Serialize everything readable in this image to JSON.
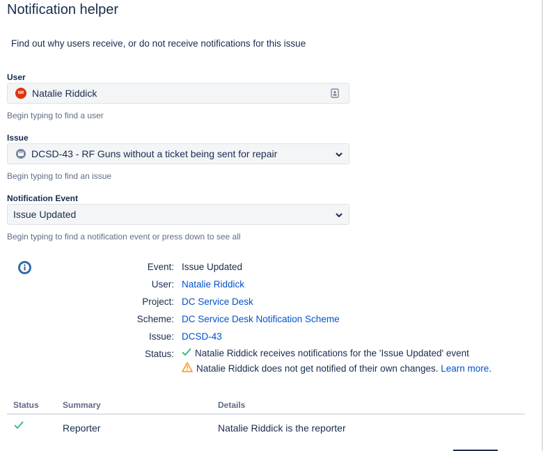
{
  "page": {
    "title": "Notification helper",
    "description": "Find out why users receive, or do not receive notifications for this issue"
  },
  "form": {
    "user": {
      "label": "User",
      "avatar_initials": "NR",
      "value": "Natalie Riddick",
      "helper": "Begin typing to find a user",
      "icon": "contact-card-icon"
    },
    "issue": {
      "label": "Issue",
      "value": "DCSD-43 - RF Guns without a ticket being sent for repair",
      "helper": "Begin typing to find an issue",
      "icon": "issue-type-icon"
    },
    "event": {
      "label": "Notification Event",
      "value": "Issue Updated",
      "helper": "Begin typing to find a notification event or press down to see all"
    }
  },
  "result": {
    "event_key": "Event:",
    "event_val": "Issue Updated",
    "user_key": "User:",
    "user_val": "Natalie Riddick",
    "project_key": "Project:",
    "project_val": "DC Service Desk",
    "scheme_key": "Scheme:",
    "scheme_val": "DC Service Desk Notification Scheme",
    "issue_key": "Issue:",
    "issue_val": "DCSD-43",
    "status_key": "Status:",
    "status_ok": "Natalie Riddick receives notifications for the 'Issue Updated' event",
    "status_warn": "Natalie Riddick does not get notified of their own changes.",
    "learn_more": "Learn more",
    "learn_more_suffix": "."
  },
  "table": {
    "headers": [
      "Status",
      "Summary",
      "Details"
    ],
    "rows": [
      {
        "status_icon": "check-icon",
        "summary": "Reporter",
        "details": "Natalie Riddick is the reporter"
      }
    ]
  },
  "colors": {
    "link": "#0052cc",
    "success": "#36b37e",
    "warning": "#ff991f",
    "avatar": "#de350b",
    "info": "#2f6ca8"
  }
}
